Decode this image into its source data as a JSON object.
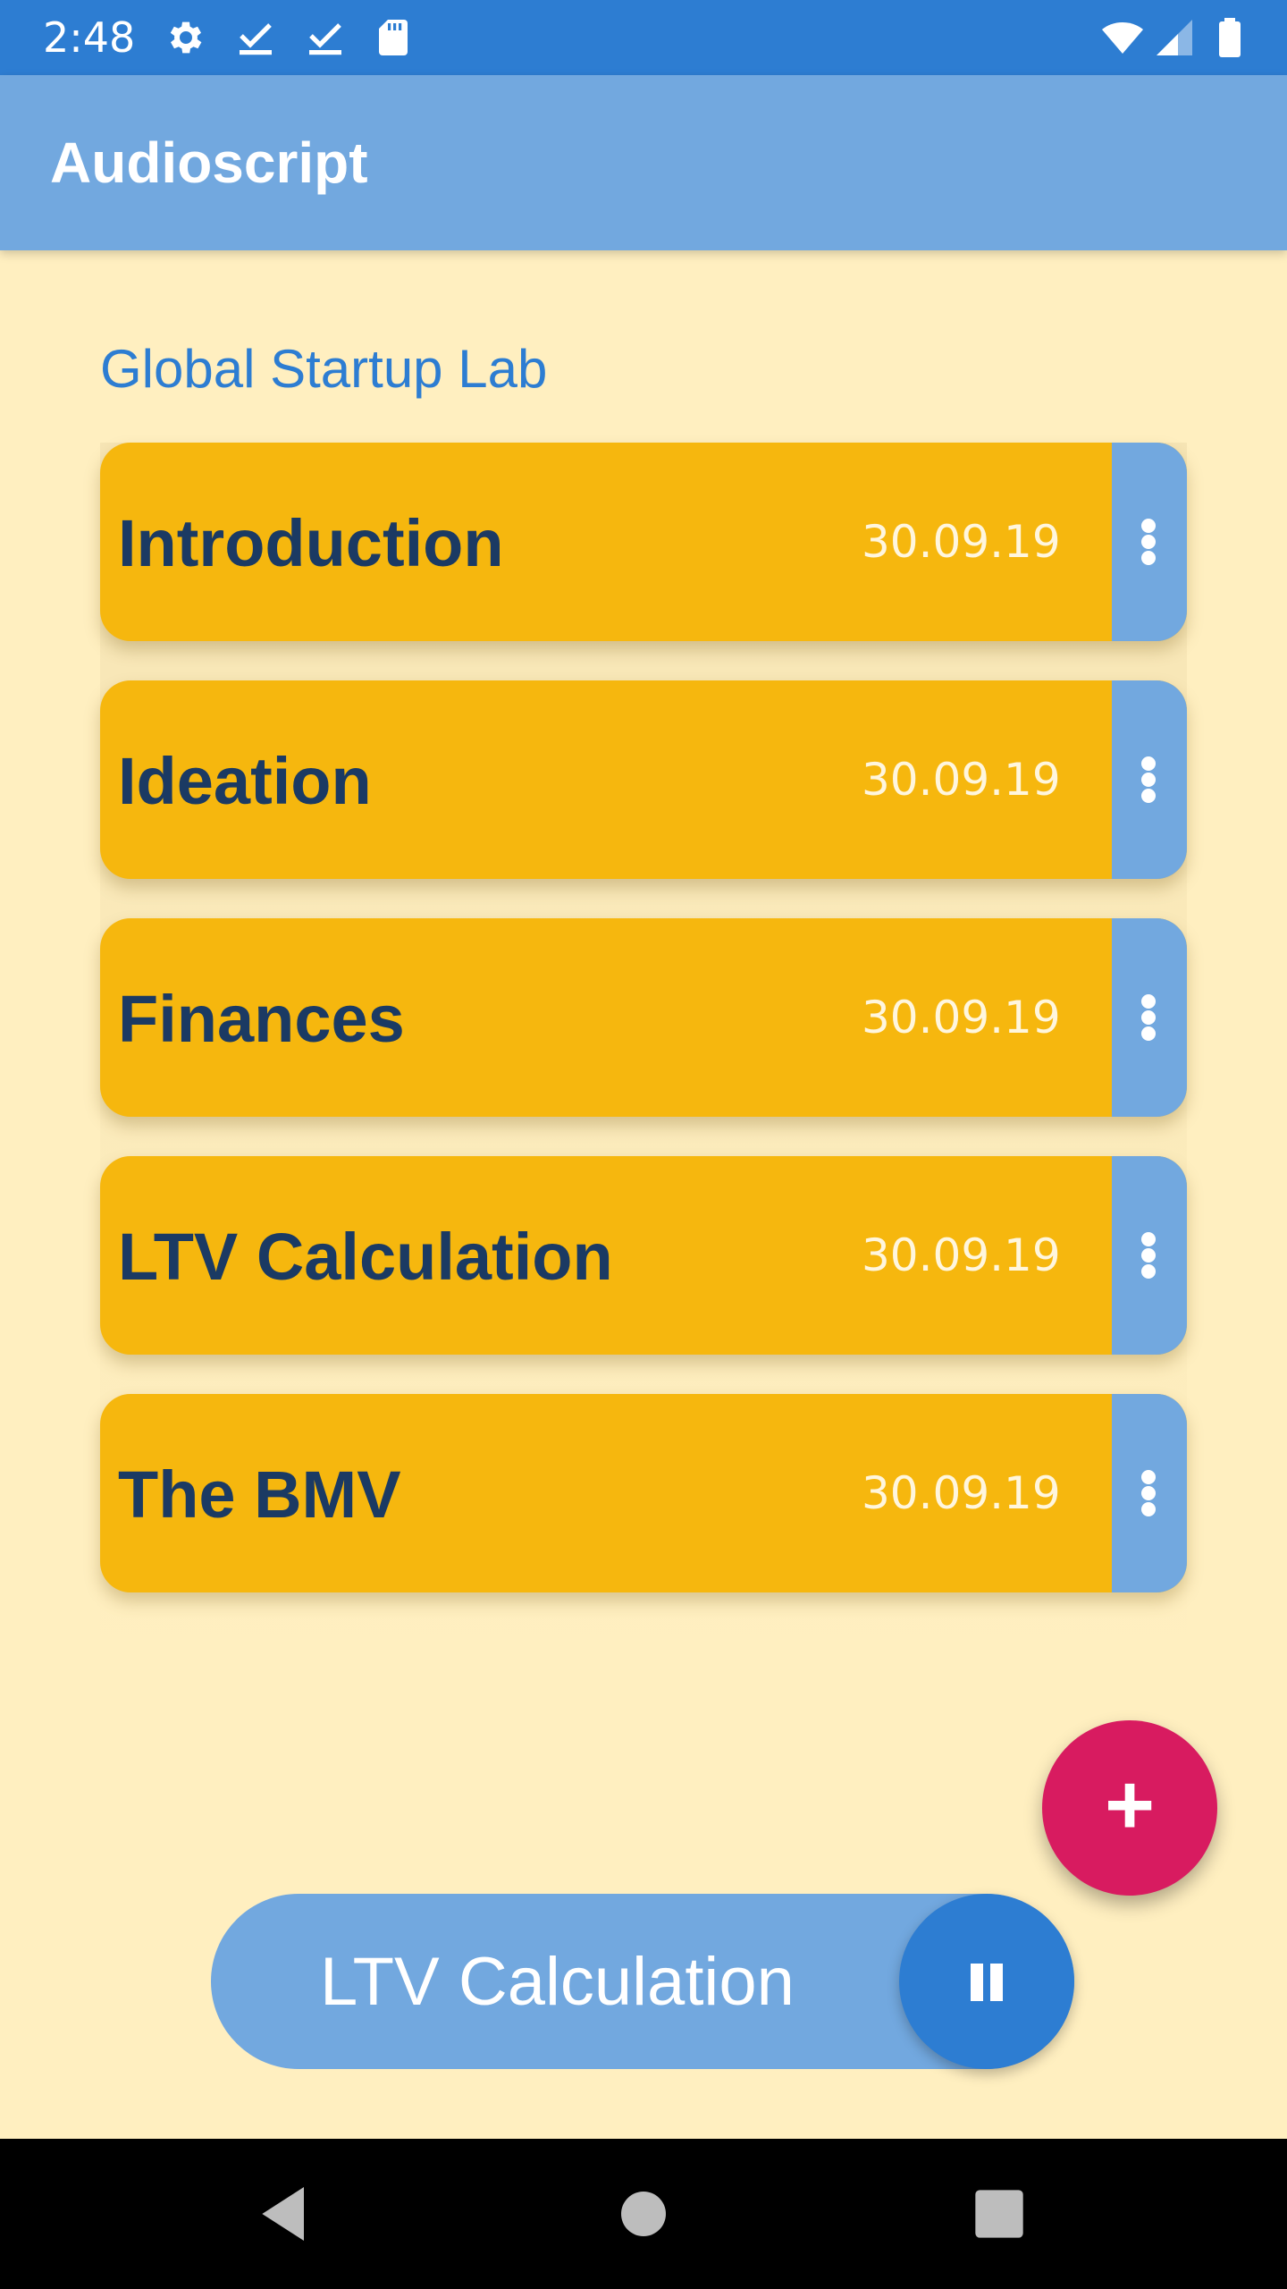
{
  "status_bar": {
    "time": "2:48",
    "icons": [
      "settings-icon",
      "check-download-icon",
      "check-download-icon",
      "sd-card-icon",
      "wifi-icon",
      "signal-icon",
      "battery-icon"
    ]
  },
  "app_bar": {
    "title": "Audioscript"
  },
  "section": {
    "title": "Global Startup Lab"
  },
  "recordings": [
    {
      "title": "Introduction",
      "date": "30.09.19"
    },
    {
      "title": "Ideation",
      "date": "30.09.19"
    },
    {
      "title": "Finances",
      "date": "30.09.19"
    },
    {
      "title": "LTV Calculation",
      "date": "30.09.19"
    },
    {
      "title": "The BMV",
      "date": "30.09.19"
    }
  ],
  "fab": {
    "label": "+"
  },
  "player": {
    "now_playing": "LTV Calculation",
    "state": "playing"
  },
  "colors": {
    "status_bar": "#2D7DD2",
    "app_bar": "#72A8DF",
    "background": "#FFEFC0",
    "card": "#F6B70E",
    "card_title": "#1B3A63",
    "fab": "#D81B60"
  }
}
